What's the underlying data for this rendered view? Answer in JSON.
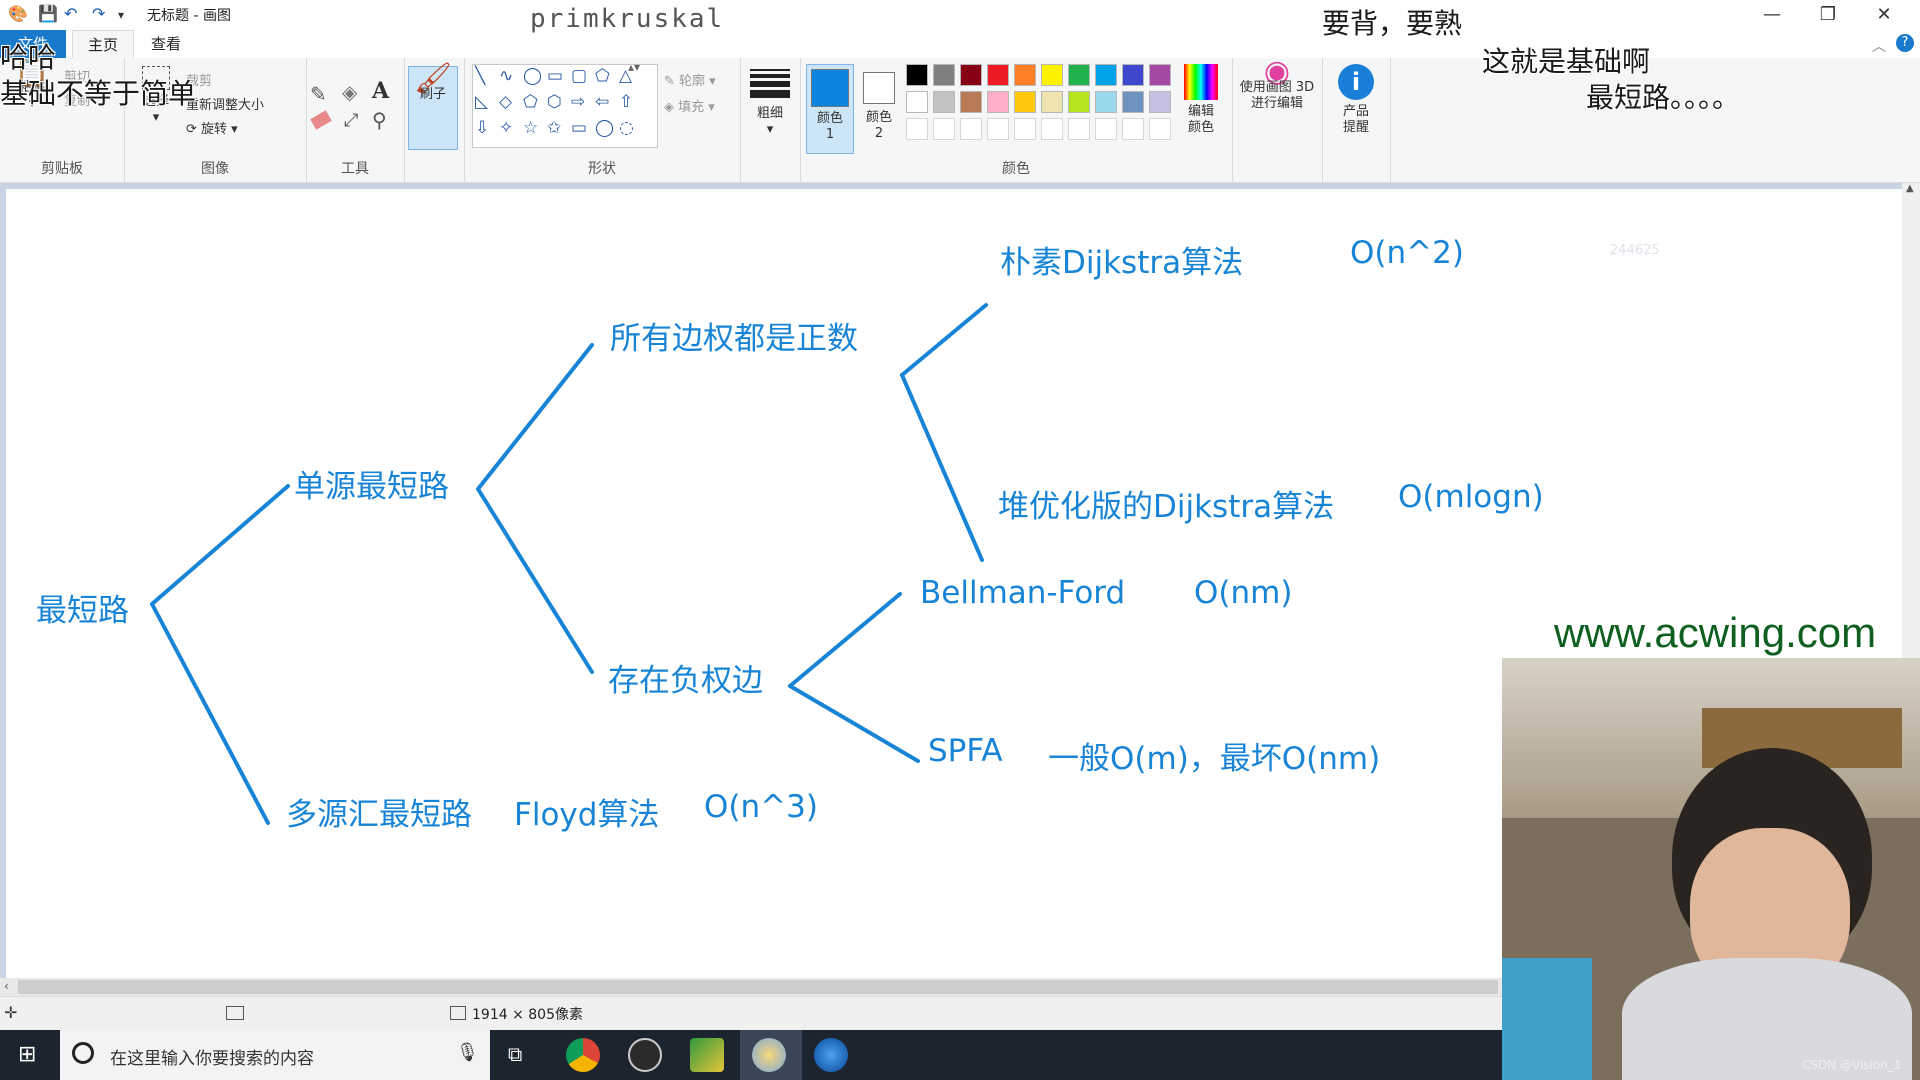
{
  "window": {
    "title": "无标题 - 画图",
    "controls": {
      "minimize": "—",
      "restore": "❐",
      "close": "✕"
    }
  },
  "ribbon_tabs": [
    "文件",
    "主页",
    "查看"
  ],
  "clipboard": {
    "paste": "粘贴",
    "cut": "剪切",
    "copy": "复制",
    "label": "剪贴板"
  },
  "image": {
    "select": "选择",
    "crop": "裁剪",
    "resize": "重新调整大小",
    "rotate": "旋转",
    "label": "图像"
  },
  "tools": {
    "label": "工具",
    "text_tool": "A"
  },
  "brushes": {
    "label": "刷子"
  },
  "shapes": {
    "outline": "轮廓",
    "fill": "填充",
    "label": "形状",
    "glyphs": [
      "╲",
      "∿",
      "◯",
      "▭",
      "▢",
      "⬠",
      "△",
      "◺",
      "◇",
      "⬠",
      "⬡",
      "⇨",
      "⇦",
      "⇧",
      "⇩",
      "✧",
      "☆",
      "✩",
      "▭",
      "◯",
      "◌"
    ]
  },
  "size": {
    "label": "粗细"
  },
  "colors": {
    "color1_label": "颜色 1",
    "color2_label": "颜色 2",
    "edit_colors": "编辑颜色",
    "label": "颜色",
    "color1": "#0a86e0",
    "color2": "#ffffff",
    "palette_row1": [
      "#000000",
      "#7f7f7f",
      "#880015",
      "#ed1c24",
      "#ff7f27",
      "#fff200",
      "#22b14c",
      "#00a2e8",
      "#3f48cc",
      "#a349a4"
    ],
    "palette_row2": [
      "#ffffff",
      "#c3c3c3",
      "#b97a57",
      "#ffaec9",
      "#ffc90e",
      "#efe4b0",
      "#b5e61d",
      "#99d9ea",
      "#7092be",
      "#c8bfe7"
    ]
  },
  "paint3d": {
    "label": "使用画图 3D 进行编辑"
  },
  "alert": {
    "label": "产品提醒"
  },
  "mindmap": {
    "root": "最短路",
    "single_source": "单源最短路",
    "all_positive": "所有边权都是正数",
    "naive_dijkstra": "朴素Dijkstra算法",
    "naive_dijkstra_cx": "O(n^2)",
    "heap_dijkstra": "堆优化版的Dijkstra算法",
    "heap_dijkstra_cx": "O(mlogn)",
    "negative": "存在负权边",
    "bellman_ford": "Bellman-Ford",
    "bellman_ford_cx": "O(nm)",
    "spfa": "SPFA",
    "spfa_cx": "一般O(m)，最坏O(nm)",
    "multi_source": "多源汇最短路",
    "floyd": "Floyd算法",
    "floyd_cx": "O(n^3)",
    "faint_label": "244625"
  },
  "statusbar": {
    "dimensions": "1914 × 805像素"
  },
  "taskbar": {
    "search_placeholder": "在这里输入你要搜索的内容"
  },
  "overlay": {
    "top_center": "primkruskal",
    "top_right_1": "要背，要熟",
    "top_right_2": "这就是基础啊",
    "top_right_3": "最短路。。。。",
    "top_left_1": "哈哈",
    "top_left_2": "基础不等于简单",
    "watermark": "www.acwing.com",
    "credit": "CSDN @Vision_1"
  }
}
